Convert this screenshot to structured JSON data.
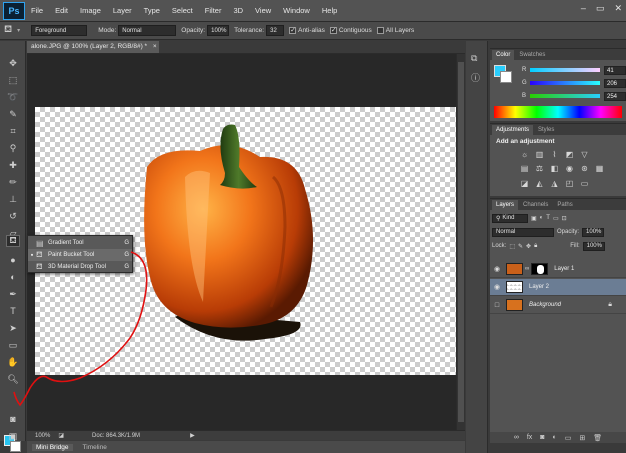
{
  "menubar": {
    "logo": "Ps",
    "items": [
      "File",
      "Edit",
      "Image",
      "Layer",
      "Type",
      "Select",
      "Filter",
      "3D",
      "View",
      "Window",
      "Help"
    ],
    "controls": [
      "–",
      "▭",
      "✕"
    ]
  },
  "options": {
    "fill_source": "Foreground",
    "mode_label": "Mode:",
    "mode_value": "Normal",
    "opacity_label": "Opacity:",
    "opacity_value": "100%",
    "tolerance_label": "Tolerance:",
    "tolerance_value": "32",
    "antialias_label": "Anti-alias",
    "contiguous_label": "Contiguous",
    "alllayers_label": "All Layers"
  },
  "document": {
    "tab_title": "alone.JPG @ 100% (Layer 2, RGB/8#) *",
    "zoom": "100%",
    "doc_info": "Doc: 864.3K/1.9M"
  },
  "flyout": {
    "items": [
      {
        "label": "Gradient Tool",
        "key": "G"
      },
      {
        "label": "Paint Bucket Tool",
        "key": "G"
      },
      {
        "label": "3D Material Drop Tool",
        "key": "G"
      }
    ]
  },
  "bottom_tabs": [
    "Mini Bridge",
    "Timeline"
  ],
  "color_panel": {
    "tabs": [
      "Color",
      "Swatches"
    ],
    "r_label": "R",
    "g_label": "G",
    "b_label": "B",
    "r_value": "41",
    "g_value": "206",
    "b_value": "254",
    "foreground_color": "#29CEFE"
  },
  "adjustments_panel": {
    "tabs": [
      "Adjustments",
      "Styles"
    ],
    "title": "Add an adjustment"
  },
  "layers_panel": {
    "tabs": [
      "Layers",
      "Channels",
      "Paths"
    ],
    "filter_label": "Kind",
    "blend_mode": "Normal",
    "opacity_label": "Opacity:",
    "opacity_value": "100%",
    "lock_label": "Lock:",
    "fill_label": "Fill:",
    "fill_value": "100%",
    "layers": [
      {
        "name": "Layer 1",
        "selected": false,
        "italic": false
      },
      {
        "name": "Layer 2",
        "selected": true,
        "italic": false
      },
      {
        "name": "Background",
        "selected": false,
        "italic": true
      }
    ]
  }
}
